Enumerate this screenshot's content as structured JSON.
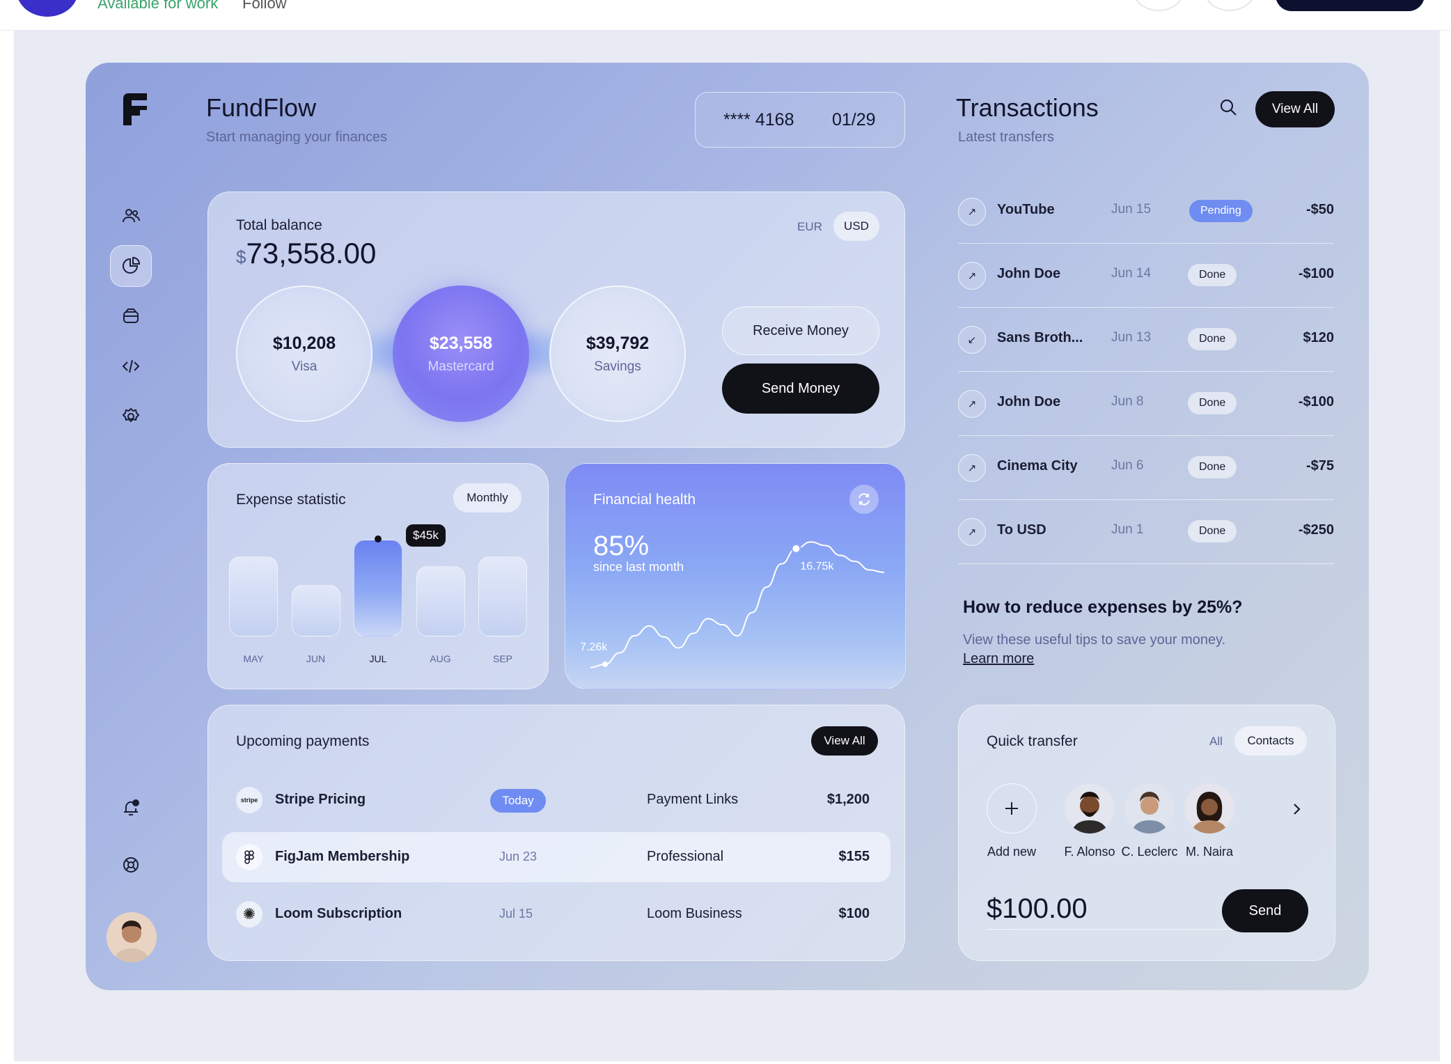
{
  "topbar": {
    "status": "Available for work",
    "follow": "Follow"
  },
  "app": {
    "name": "FundFlow",
    "tagline": "Start managing your finances"
  },
  "card": {
    "masked": "**** 4168",
    "expiry": "01/29"
  },
  "balance": {
    "label": "Total balance",
    "currency_symbol": "$",
    "amount": "73,558.00",
    "currencies": [
      "EUR",
      "USD"
    ],
    "active_currency": "USD",
    "accounts": [
      {
        "amount": "$10,208",
        "label": "Visa"
      },
      {
        "amount": "$23,558",
        "label": "Mastercard"
      },
      {
        "amount": "$39,792",
        "label": "Savings"
      }
    ],
    "receive_label": "Receive Money",
    "send_label": "Send Money"
  },
  "expense": {
    "title": "Expense statistic",
    "period": "Monthly",
    "tooltip": "$45k",
    "chart_data": {
      "type": "bar",
      "categories": [
        "MAY",
        "JUN",
        "JUL",
        "AUG",
        "SEP"
      ],
      "values": [
        0.78,
        0.5,
        0.94,
        0.68,
        0.78
      ],
      "highlight": "JUL",
      "annotation": "$45k"
    }
  },
  "health": {
    "title": "Financial health",
    "percent": "85%",
    "subtitle": "since last month",
    "low_label": "7.26k",
    "high_label": "16.75k",
    "chart_data": {
      "type": "line",
      "x": [
        0,
        1,
        2,
        3,
        4,
        5,
        6,
        7,
        8,
        9,
        10,
        11,
        12,
        13,
        14,
        15,
        16,
        17,
        18,
        19,
        20
      ],
      "y": [
        7.0,
        7.26,
        8.2,
        9.6,
        10.4,
        9.5,
        8.6,
        9.8,
        11.0,
        10.5,
        9.6,
        11.5,
        13.6,
        15.5,
        16.75,
        17.3,
        17.0,
        16.2,
        15.7,
        15.0,
        14.8
      ],
      "points": [
        {
          "x": 1,
          "y": 7.26,
          "label": "7.26k"
        },
        {
          "x": 14,
          "y": 16.75,
          "label": "16.75k"
        }
      ]
    }
  },
  "payments": {
    "title": "Upcoming payments",
    "view_all": "View All",
    "rows": [
      {
        "icon": "stripe",
        "name": "Stripe Pricing",
        "date": "Today",
        "plan": "Payment Links",
        "amount": "$1,200"
      },
      {
        "icon": "figma",
        "name": "FigJam Membership",
        "date": "Jun 23",
        "plan": "Professional",
        "amount": "$155"
      },
      {
        "icon": "loom",
        "name": "Loom Subscription",
        "date": "Jul 15",
        "plan": "Loom Business",
        "amount": "$100"
      }
    ]
  },
  "transactions": {
    "title": "Transactions",
    "subtitle": "Latest transfers",
    "view_all": "View All",
    "rows": [
      {
        "dir": "↗",
        "name": "YouTube",
        "date": "Jun 15",
        "status": "Pending",
        "amount": "-$50"
      },
      {
        "dir": "↗",
        "name": "John Doe",
        "date": "Jun 14",
        "status": "Done",
        "amount": "-$100"
      },
      {
        "dir": "↙",
        "name": "Sans Broth...",
        "date": "Jun 13",
        "status": "Done",
        "amount": "$120"
      },
      {
        "dir": "↗",
        "name": "John Doe",
        "date": "Jun 8",
        "status": "Done",
        "amount": "-$100"
      },
      {
        "dir": "↗",
        "name": "Cinema City",
        "date": "Jun 6",
        "status": "Done",
        "amount": "-$75"
      },
      {
        "dir": "↗",
        "name": "To USD",
        "date": "Jun 1",
        "status": "Done",
        "amount": "-$250"
      }
    ]
  },
  "tips": {
    "title": "How to reduce expenses by 25%?",
    "body": "View these useful tips to save your money.",
    "link": "Learn more"
  },
  "quick": {
    "title": "Quick transfer",
    "filters": [
      "All",
      "Contacts"
    ],
    "add_label": "Add new",
    "contacts": [
      "F. Alonso",
      "C. Leclerc",
      "M. Naira"
    ],
    "amount": "$100.00",
    "send": "Send"
  },
  "colors": {
    "accent": "#7b7ef3",
    "dark": "#111118",
    "pending": "#6f8cf2"
  }
}
